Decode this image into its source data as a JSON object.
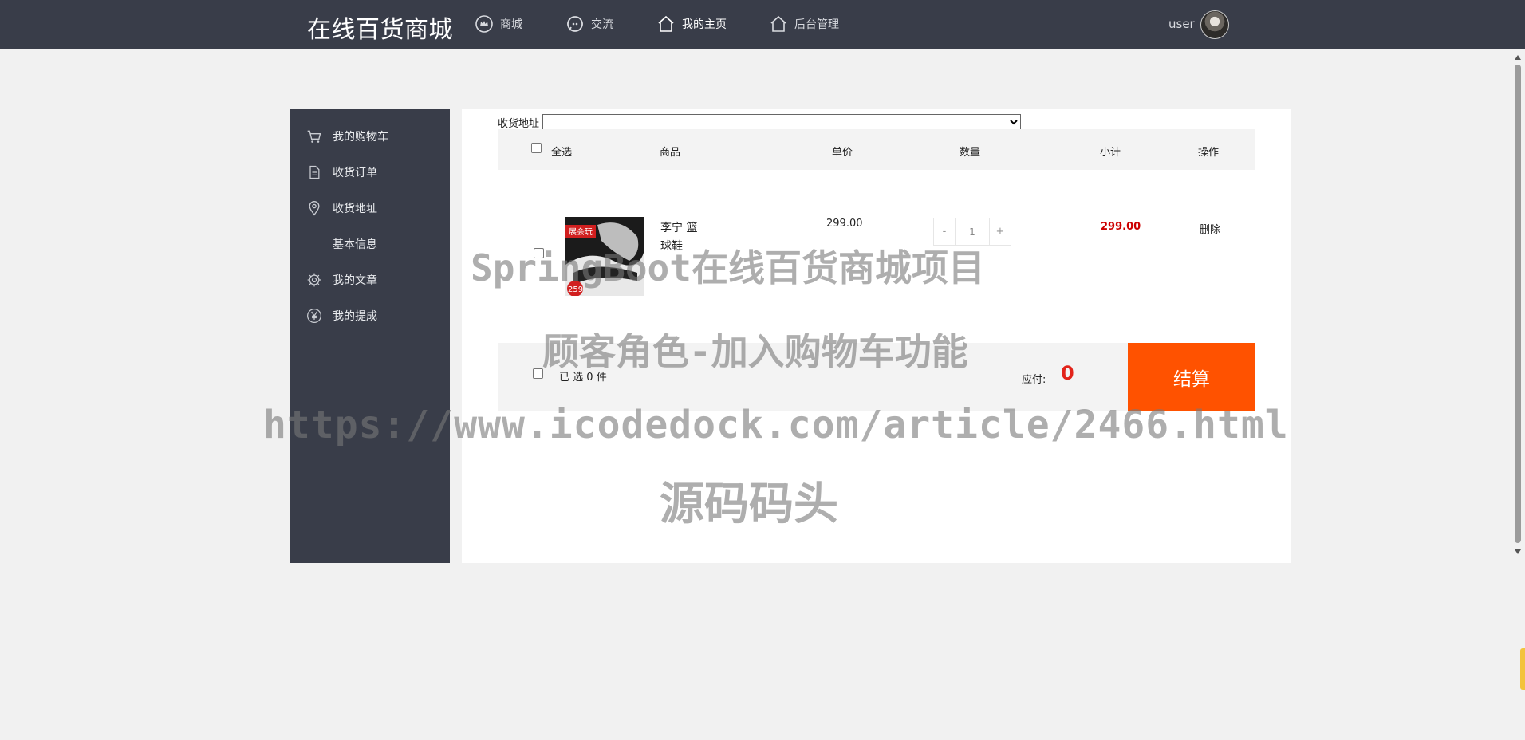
{
  "header": {
    "brand": "在线百货商城",
    "nav": [
      {
        "label": "商城",
        "icon": "crown-icon",
        "active": false
      },
      {
        "label": "交流",
        "icon": "chat-icon",
        "active": false
      },
      {
        "label": "我的主页",
        "icon": "home-icon",
        "active": true
      },
      {
        "label": "后台管理",
        "icon": "home-icon",
        "active": false
      }
    ],
    "username": "user"
  },
  "sidebar": {
    "items": [
      {
        "label": "我的购物车",
        "icon": "cart-icon"
      },
      {
        "label": "收货订单",
        "icon": "document-icon"
      },
      {
        "label": "收货地址",
        "icon": "location-icon"
      },
      {
        "label": "基本信息",
        "icon": ""
      },
      {
        "label": "我的文章",
        "icon": "gear-icon"
      },
      {
        "label": "我的提成",
        "icon": "yen-icon"
      }
    ]
  },
  "cart": {
    "address_label": "收货地址",
    "address_value": "",
    "columns": {
      "select_all": "全选",
      "product": "商品",
      "unit_price": "单价",
      "quantity": "数量",
      "subtotal": "小计",
      "action": "操作"
    },
    "items": [
      {
        "name": "李宁 篮球鞋",
        "price": "299.00",
        "qty": "1",
        "subtotal": "299.00",
        "action": "删除"
      }
    ],
    "footer": {
      "selected_prefix": "已 选",
      "selected_count": "0",
      "selected_unit": "件",
      "payable_label": "应付:",
      "payable_value": "0",
      "checkout_label": "结算"
    }
  },
  "watermark": {
    "line1": "SpringBoot在线百货商城项目",
    "line2": "顾客角色-加入购物车功能",
    "line3": "https://www.icodedock.com/article/2466.html",
    "line4": "源码码头"
  },
  "product_image": {
    "badge_text": "259",
    "caption": "展会玩"
  }
}
